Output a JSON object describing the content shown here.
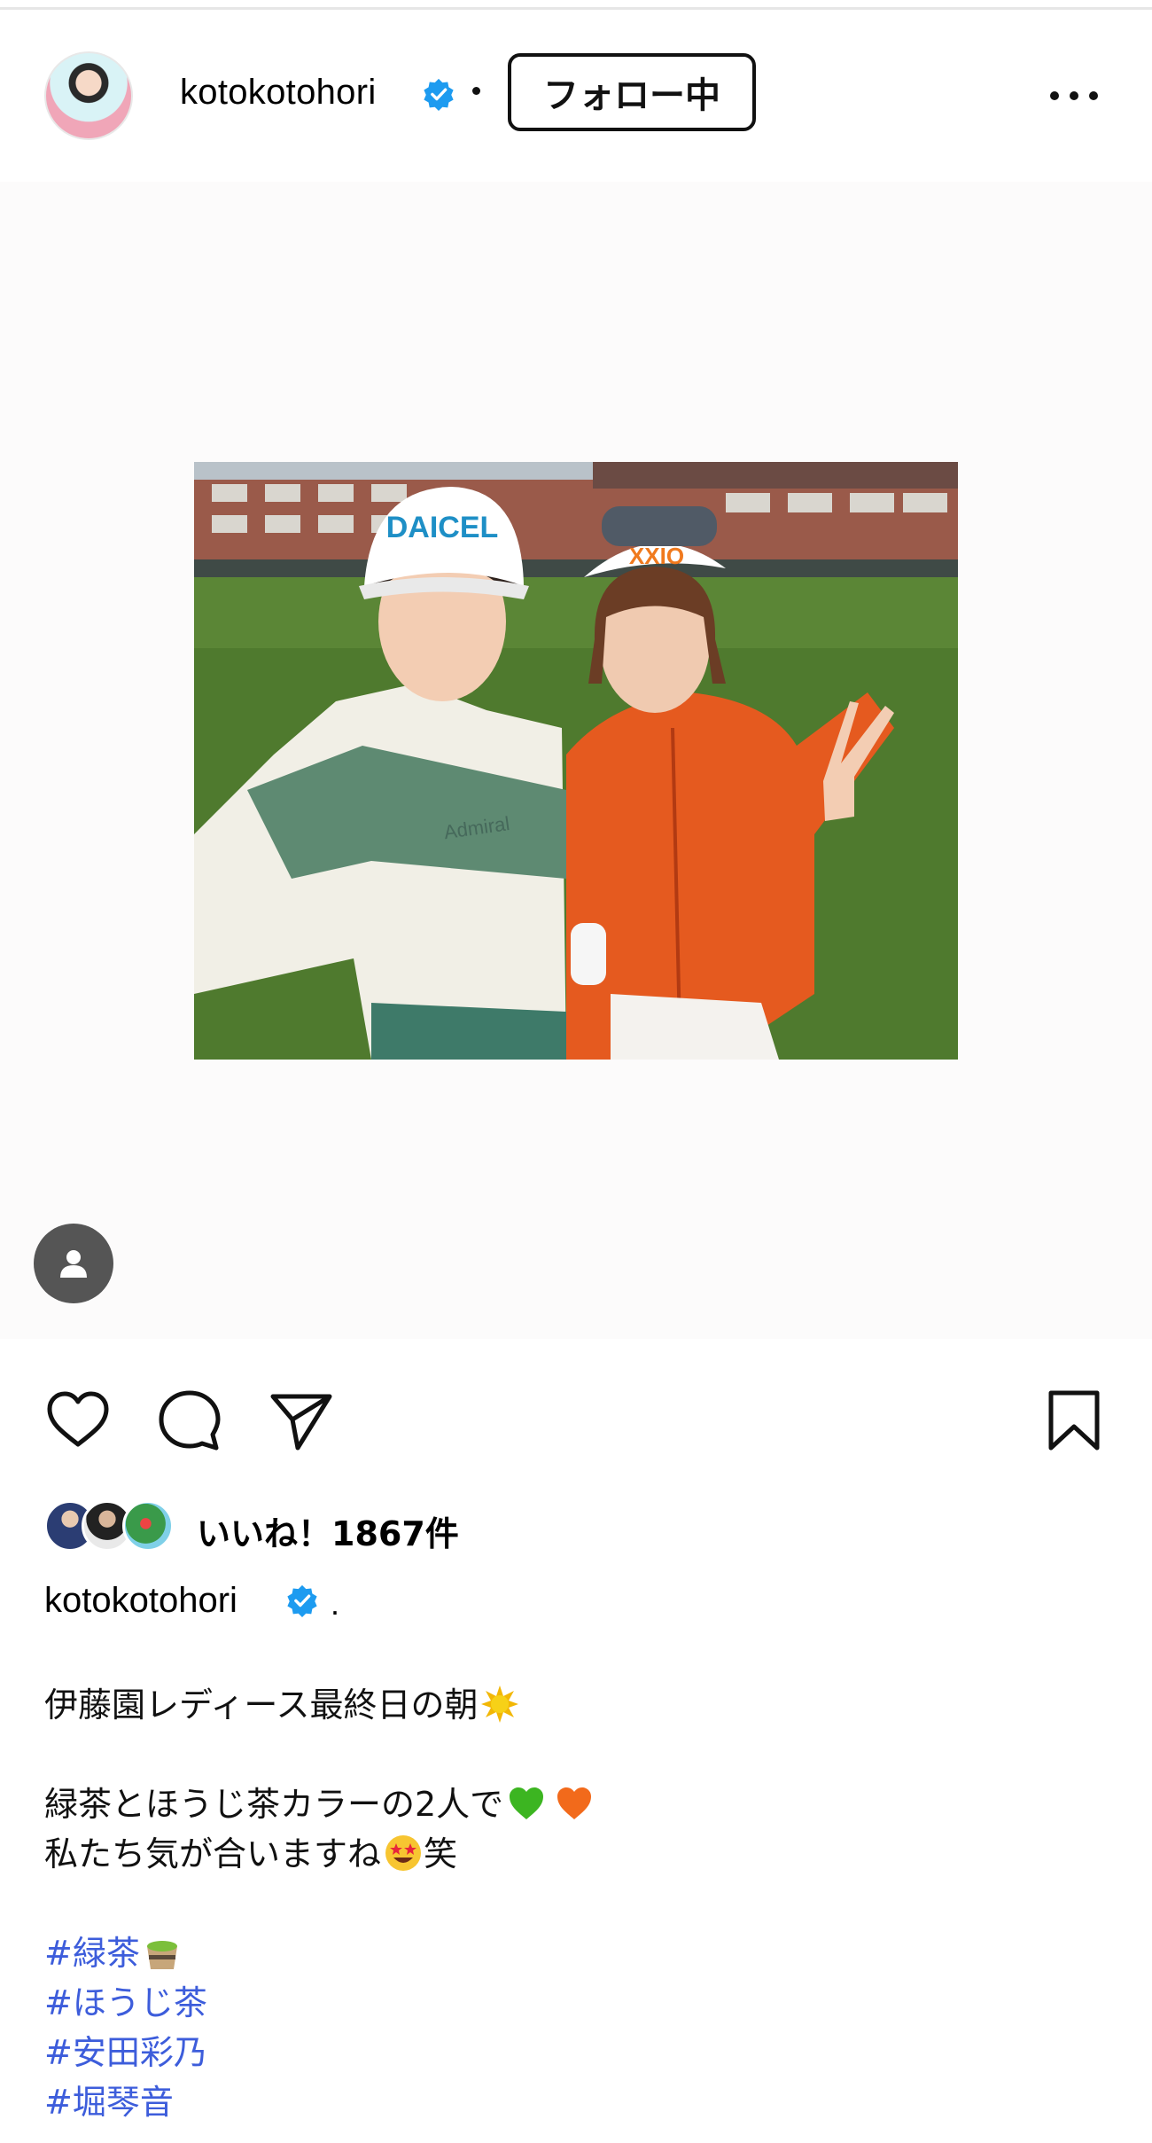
{
  "post": {
    "username": "kotokotohori",
    "follow_label": "フォロー中",
    "likes_text": "いいね！1867件",
    "caption_username": "kotokotohori",
    "caption_period": ".",
    "caption_lines": [
      "伊藤園レディース最終日の朝",
      "緑茶とほうじ茶カラーの2人で",
      "私たち気が合いますね",
      "笑"
    ],
    "hashtags": [
      "#緑茶",
      "#ほうじ茶",
      "#安田彩乃",
      "#堀琴音"
    ]
  },
  "photo": {
    "cap_left_text": "DAICEL",
    "cap_right_text": "XXIO",
    "shirt_text": "Admiral"
  },
  "icons": {
    "verified": "verified-badge-icon",
    "more": "more-dots-icon",
    "tag": "person-tag-icon",
    "like": "heart-icon",
    "comment": "comment-icon",
    "share": "send-icon",
    "save": "bookmark-icon"
  },
  "colors": {
    "verified_blue": "#1d9bf0",
    "hashtag": "#3d5ddb",
    "grass": "#4f7a2e"
  }
}
